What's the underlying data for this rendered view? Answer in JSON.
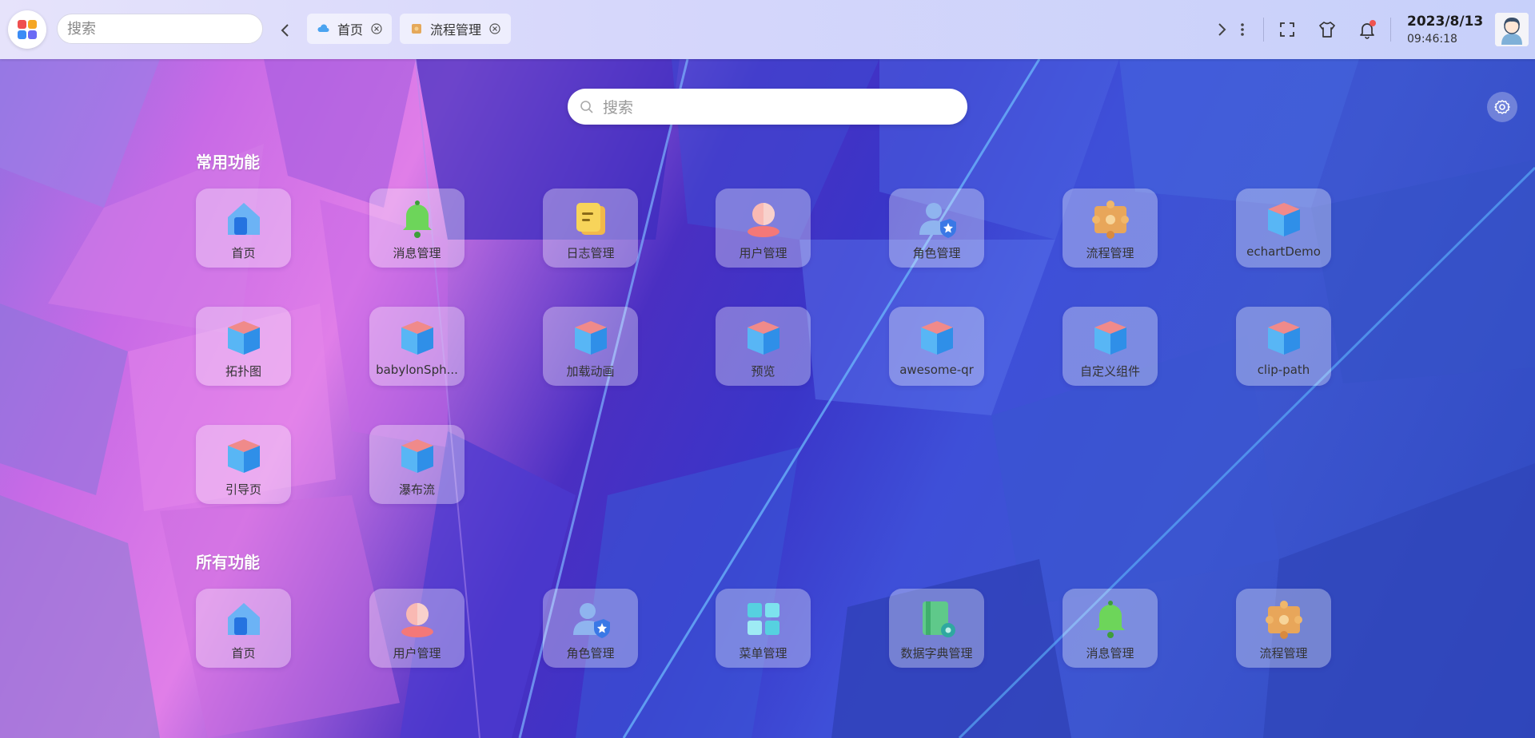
{
  "topbar": {
    "search_placeholder": "搜索",
    "tabs": [
      {
        "label": "首页",
        "icon": "cloud-icon"
      },
      {
        "label": "流程管理",
        "icon": "workflow-icon"
      }
    ],
    "date": "2023/8/13",
    "time": "09:46:18",
    "notification_dot_color": "#f0534f"
  },
  "main": {
    "search_placeholder": "搜索",
    "common_title": "常用功能",
    "all_title": "所有功能",
    "common_apps": [
      {
        "label": "首页",
        "icon": "home-icon"
      },
      {
        "label": "消息管理",
        "icon": "bell-icon"
      },
      {
        "label": "日志管理",
        "icon": "log-icon"
      },
      {
        "label": "用户管理",
        "icon": "user-icon"
      },
      {
        "label": "角色管理",
        "icon": "role-icon"
      },
      {
        "label": "流程管理",
        "icon": "workflow-icon"
      },
      {
        "label": "echartDemo",
        "icon": "cube-icon"
      },
      {
        "label": "拓扑图",
        "icon": "cube-icon"
      },
      {
        "label": "babylonSph...",
        "icon": "cube-icon"
      },
      {
        "label": "加载动画",
        "icon": "cube-icon"
      },
      {
        "label": "预览",
        "icon": "cube-icon"
      },
      {
        "label": "awesome-qr",
        "icon": "cube-icon"
      },
      {
        "label": "自定义组件",
        "icon": "cube-icon"
      },
      {
        "label": "clip-path",
        "icon": "cube-icon"
      },
      {
        "label": "引导页",
        "icon": "cube-icon"
      },
      {
        "label": "瀑布流",
        "icon": "cube-icon"
      }
    ],
    "all_apps": [
      {
        "label": "首页",
        "icon": "home-icon"
      },
      {
        "label": "用户管理",
        "icon": "user-icon"
      },
      {
        "label": "角色管理",
        "icon": "role-icon"
      },
      {
        "label": "菜单管理",
        "icon": "menu-grid-icon"
      },
      {
        "label": "数据字典管理",
        "icon": "dictionary-icon"
      },
      {
        "label": "消息管理",
        "icon": "bell-icon"
      },
      {
        "label": "流程管理",
        "icon": "workflow-icon"
      }
    ]
  },
  "colors": {
    "cube_top": "#f08a8a",
    "cube_left": "#58b6f5",
    "cube_right": "#2f8fe8"
  }
}
